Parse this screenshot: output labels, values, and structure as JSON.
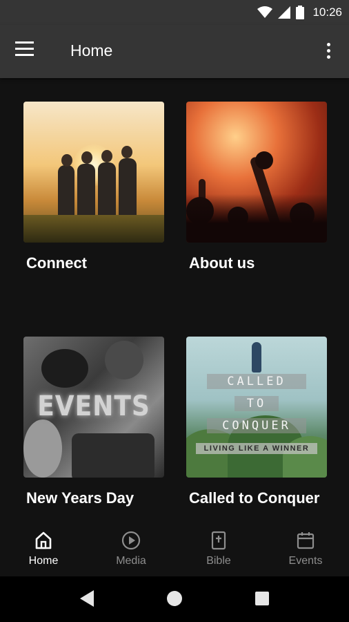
{
  "status_bar": {
    "time": "10:26"
  },
  "app_bar": {
    "title": "Home"
  },
  "cards": [
    {
      "label": "Connect"
    },
    {
      "label": "About us"
    },
    {
      "label": "New Years Day",
      "image_text": "EVENTS"
    },
    {
      "label": "Called to Conquer",
      "image_lines": [
        "CALLED",
        "TO",
        "CONQUER"
      ],
      "image_subtitle": "LIVING LIKE A WINNER"
    }
  ],
  "bottom_nav": [
    {
      "label": "Home",
      "icon": "home-icon",
      "active": true
    },
    {
      "label": "Media",
      "icon": "play-circle-icon",
      "active": false
    },
    {
      "label": "Bible",
      "icon": "bible-icon",
      "active": false
    },
    {
      "label": "Events",
      "icon": "calendar-icon",
      "active": false
    }
  ],
  "colors": {
    "app_bar": "#353535",
    "background": "#121212",
    "active_nav": "#ffffff",
    "inactive_nav": "#8e8e8e"
  }
}
